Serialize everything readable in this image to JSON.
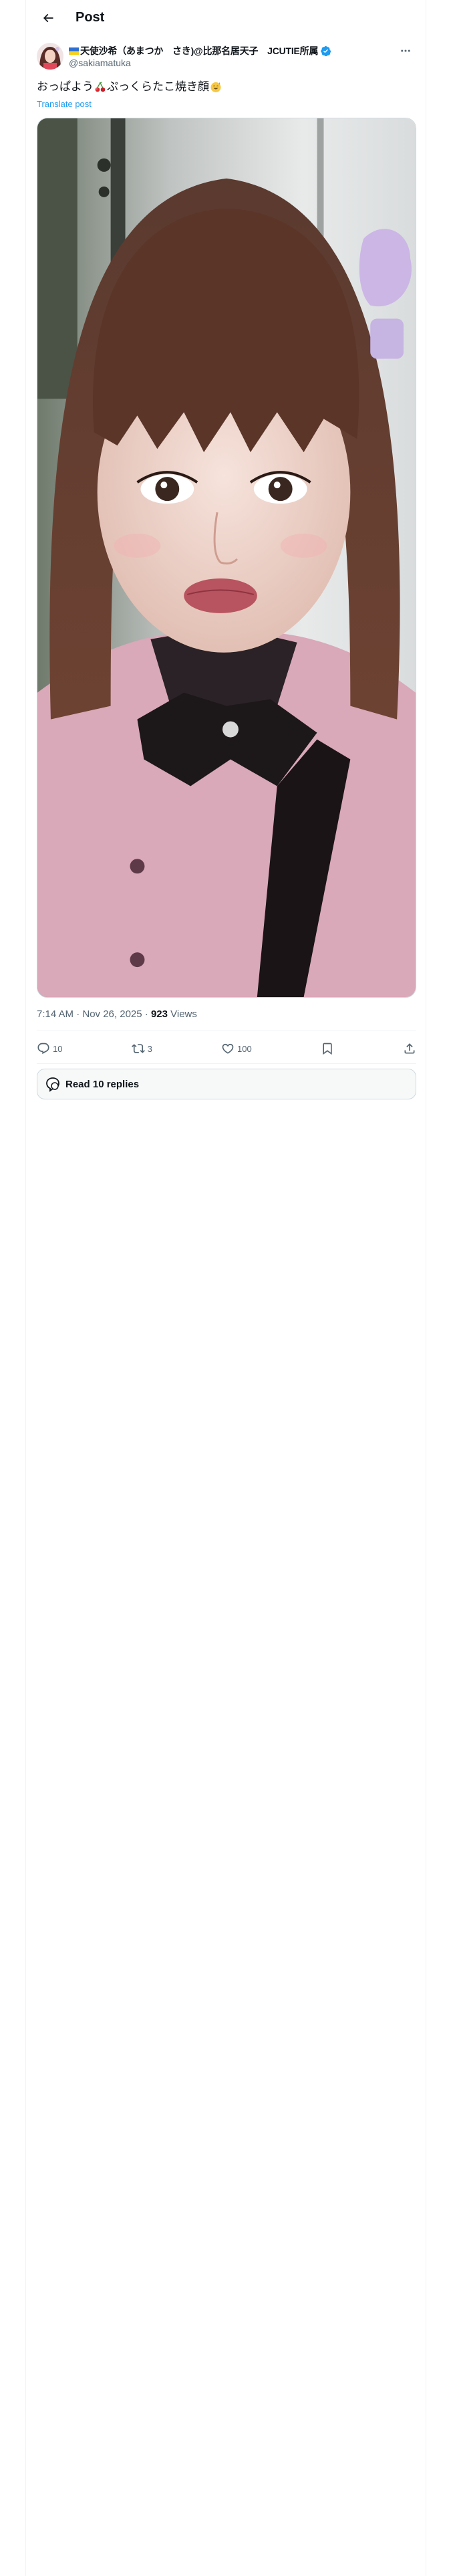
{
  "header": {
    "title": "Post",
    "back_icon": "arrow-left-icon"
  },
  "author": {
    "name": "天使沙希（あまつか　さき)@比那名居天子　JCUTIE所属",
    "handle": "@sakiamatuka",
    "verified": true,
    "flag_icon": "ukraine-flag-icon",
    "more_icon": "more-dots-icon"
  },
  "post": {
    "text_part1": "おっぱよう",
    "text_part2": "ぷっくらたこ焼き顔",
    "emoji_1": "cherries-emoji",
    "emoji_2": "sweat-smile-emoji",
    "translate_label": "Translate post"
  },
  "meta": {
    "time": "7:14 AM · Nov 26, 2025 · ",
    "views_count": "923",
    "views_label": " Views"
  },
  "actions": {
    "replies": "10",
    "reposts": "3",
    "likes": "100"
  },
  "read_replies": {
    "label": "Read 10 replies"
  },
  "colors": {
    "accent": "#1d9bf0",
    "secondary_text": "#536471",
    "border": "#cfd9de",
    "divider": "#eff3f4"
  }
}
